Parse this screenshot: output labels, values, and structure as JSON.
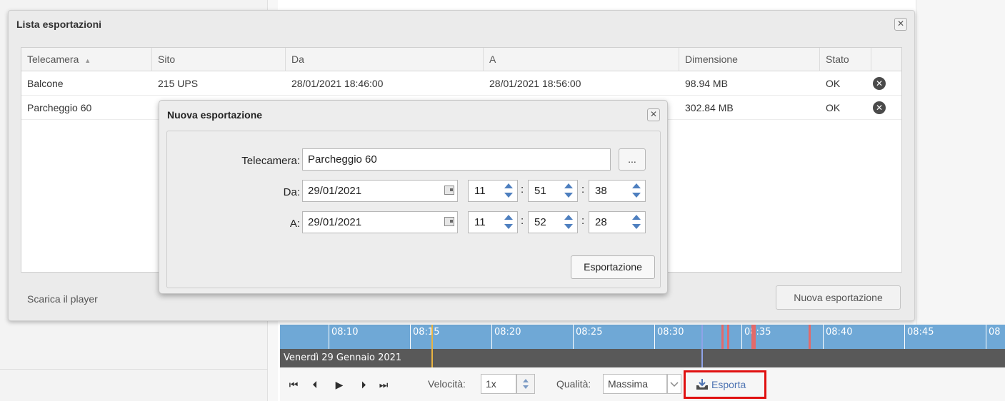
{
  "export_list": {
    "title": "Lista esportazioni",
    "close_glyph": "✕",
    "columns": [
      "Telecamera",
      "Sito",
      "Da",
      "A",
      "Dimensione",
      "Stato"
    ],
    "sort_indicator": "▲",
    "rows": [
      {
        "camera": "Balcone",
        "site": "215 UPS",
        "from": "28/01/2021 18:46:00",
        "to": "28/01/2021 18:56:00",
        "size": "98.94 MB",
        "status": "OK"
      },
      {
        "camera": "Parcheggio 60",
        "size": "302.84 MB",
        "status": "OK"
      }
    ],
    "download_player": "Scarica il player",
    "new_export_button": "Nuova esportazione"
  },
  "new_export_dialog": {
    "title": "Nuova esportazione",
    "close_glyph": "✕",
    "camera_label": "Telecamera:",
    "camera_value": "Parcheggio 60",
    "browse_label": "...",
    "from_label": "Da:",
    "from_date": "29/01/2021",
    "from_hour": "11",
    "from_minute": "51",
    "from_second": "38",
    "to_label": "A:",
    "to_date": "29/01/2021",
    "to_hour": "11",
    "to_minute": "52",
    "to_second": "28",
    "time_separator": ":",
    "export_button": "Esportazione"
  },
  "timeline": {
    "ticks": [
      "08:10",
      "08:15",
      "08:20",
      "08:25",
      "08:30",
      "08:35",
      "08:40",
      "08:45",
      "08"
    ],
    "date_label": "Venerdì 29 Gennaio 2021"
  },
  "playback": {
    "speed_label": "Velocità:",
    "speed_value": "1x",
    "quality_label": "Qualità:",
    "quality_value": "Massima",
    "export_label": "Esporta"
  },
  "colors": {
    "timeline_blue": "#6fa8d6",
    "highlight_red": "#e01010",
    "accent_blue": "#4e74b3"
  },
  "icons": [
    "close-icon",
    "sort-asc-icon",
    "delete-icon",
    "calendar-icon",
    "spin-up-icon",
    "spin-down-icon",
    "skip-first-icon",
    "step-back-icon",
    "play-icon",
    "step-forward-icon",
    "skip-last-icon",
    "export-icon"
  ]
}
